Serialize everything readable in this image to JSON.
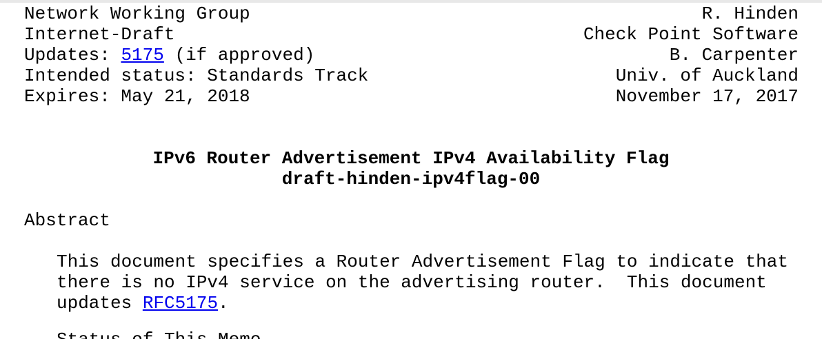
{
  "header": {
    "left": [
      "Network Working Group",
      "Internet-Draft",
      "Intended status: Standards Track",
      "Expires: May 21, 2018"
    ],
    "updates": {
      "prefix": "Updates: ",
      "link": "5175",
      "suffix": " (if approved)"
    },
    "right": [
      "R. Hinden",
      "Check Point Software",
      "B. Carpenter",
      "Univ. of Auckland",
      "November 17, 2017"
    ]
  },
  "title": {
    "line1": "IPv6 Router Advertisement IPv4 Availability Flag",
    "line2": "draft-hinden-ipv4flag-00"
  },
  "abstract": {
    "heading": "Abstract",
    "line1": "This document specifies a Router Advertisement Flag to indicate that",
    "line2": "there is no IPv4 service on the advertising router.  This document",
    "line3_prefix": "updates ",
    "line3_link": "RFC5175",
    "line3_suffix": "."
  },
  "next_section_partial": "Status of This Memo",
  "colors": {
    "link": "#0000ee",
    "text": "#000000",
    "background": "#ffffff"
  }
}
